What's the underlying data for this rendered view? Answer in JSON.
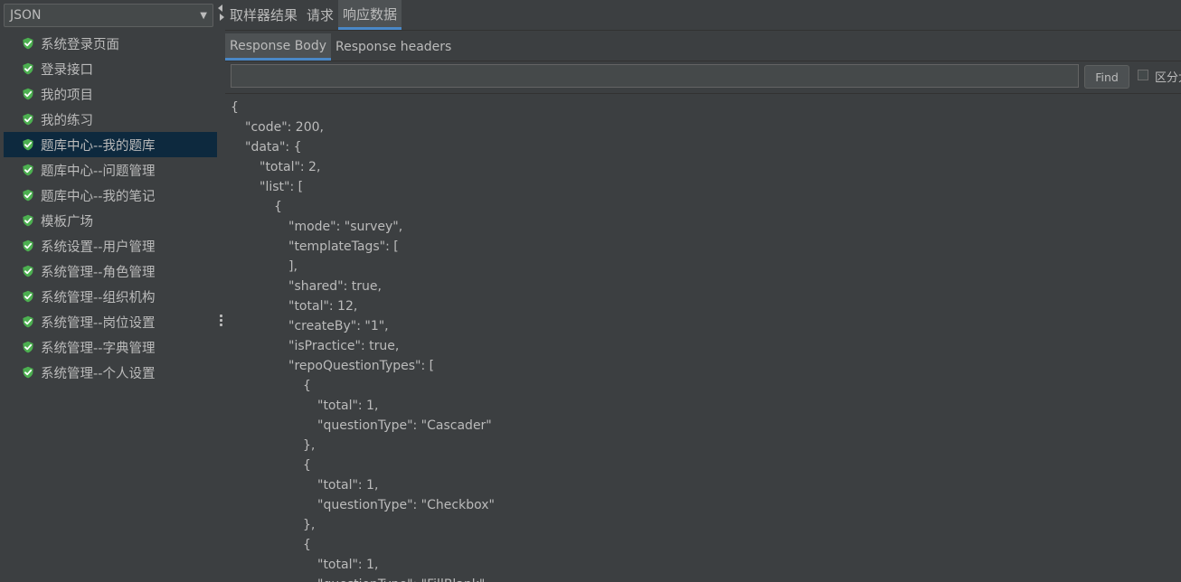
{
  "renderer": {
    "selected": "JSON"
  },
  "tree": {
    "items": [
      {
        "label": "系统登录页面",
        "selected": false
      },
      {
        "label": "登录接口",
        "selected": false
      },
      {
        "label": "我的项目",
        "selected": false
      },
      {
        "label": "我的练习",
        "selected": false
      },
      {
        "label": "题库中心--我的题库",
        "selected": true
      },
      {
        "label": "题库中心--问题管理",
        "selected": false
      },
      {
        "label": "题库中心--我的笔记",
        "selected": false
      },
      {
        "label": "模板广场",
        "selected": false
      },
      {
        "label": "系统设置--用户管理",
        "selected": false
      },
      {
        "label": "系统管理--角色管理",
        "selected": false
      },
      {
        "label": "系统管理--组织机构",
        "selected": false
      },
      {
        "label": "系统管理--岗位设置",
        "selected": false
      },
      {
        "label": "系统管理--字典管理",
        "selected": false
      },
      {
        "label": "系统管理--个人设置",
        "selected": false
      }
    ],
    "status_icon": "success-check-shield-icon",
    "status_color": "#4caf50"
  },
  "tabs": {
    "top": [
      {
        "label": "取样器结果",
        "active": false
      },
      {
        "label": "请求",
        "active": false
      },
      {
        "label": "响应数据",
        "active": true
      }
    ],
    "sub": [
      {
        "label": "Response Body",
        "active": true
      },
      {
        "label": "Response headers",
        "active": false
      }
    ]
  },
  "search": {
    "value": "",
    "find_label": "Find",
    "case_label": "区分大小写",
    "case_checked": false
  },
  "response_body": {
    "lines": [
      {
        "indent": 0,
        "text": "{"
      },
      {
        "indent": 1,
        "text": "\"code\": 200,"
      },
      {
        "indent": 1,
        "text": "\"data\": {"
      },
      {
        "indent": 2,
        "text": "\"total\": 2,"
      },
      {
        "indent": 2,
        "text": "\"list\": ["
      },
      {
        "indent": 3,
        "text": "{"
      },
      {
        "indent": 4,
        "text": "\"mode\": \"survey\","
      },
      {
        "indent": 4,
        "text": "\"templateTags\": ["
      },
      {
        "indent": 4,
        "text": "],"
      },
      {
        "indent": 4,
        "text": "\"shared\": true,"
      },
      {
        "indent": 4,
        "text": "\"total\": 12,"
      },
      {
        "indent": 4,
        "text": "\"createBy\": \"1\","
      },
      {
        "indent": 4,
        "text": "\"isPractice\": true,"
      },
      {
        "indent": 4,
        "text": "\"repoQuestionTypes\": ["
      },
      {
        "indent": 5,
        "text": "{"
      },
      {
        "indent": 6,
        "text": "\"total\": 1,"
      },
      {
        "indent": 6,
        "text": "\"questionType\": \"Cascader\""
      },
      {
        "indent": 5,
        "text": "},"
      },
      {
        "indent": 5,
        "text": "{"
      },
      {
        "indent": 6,
        "text": "\"total\": 1,"
      },
      {
        "indent": 6,
        "text": "\"questionType\": \"Checkbox\""
      },
      {
        "indent": 5,
        "text": "},"
      },
      {
        "indent": 5,
        "text": "{"
      },
      {
        "indent": 6,
        "text": "\"total\": 1,"
      },
      {
        "indent": 6,
        "text": "\"questionType\": \"FillBlank\""
      }
    ]
  },
  "colors": {
    "background": "#3c3f41",
    "selection": "#0d293e",
    "tab_accent": "#4a88c7",
    "text": "#bbbbbb"
  }
}
